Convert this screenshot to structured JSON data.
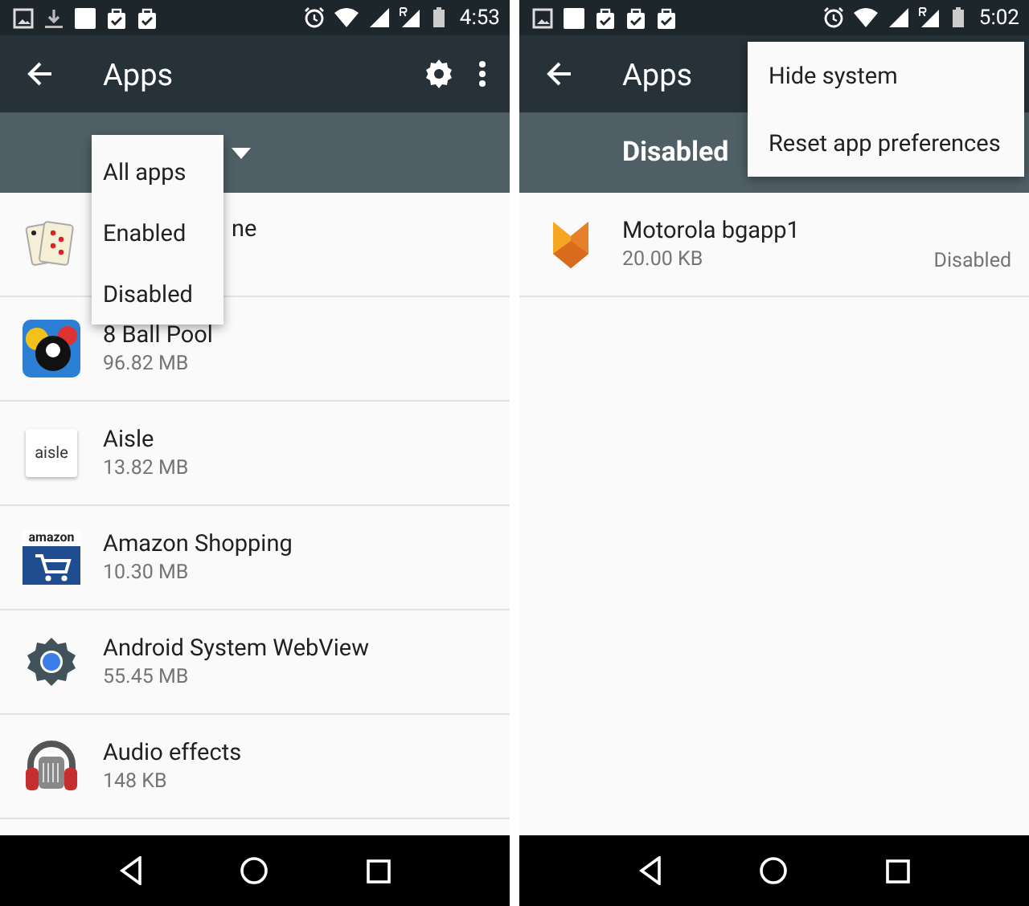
{
  "screens": [
    {
      "status_bar": {
        "notification_icons": [
          {
            "kind": "image"
          },
          {
            "kind": "download"
          },
          {
            "kind": "blank"
          },
          {
            "kind": "clipboard"
          },
          {
            "kind": "clipboard"
          }
        ],
        "system_icons": [
          {
            "kind": "alarm"
          },
          {
            "kind": "wifi"
          },
          {
            "kind": "signal"
          },
          {
            "kind": "roaming"
          },
          {
            "kind": "battery"
          }
        ],
        "time": "4:53"
      },
      "toolbar": {
        "title": "Apps",
        "actions": [
          {
            "kind": "settings"
          },
          {
            "kind": "more"
          }
        ]
      },
      "filter": {
        "expanded": true,
        "options": [
          {
            "label": "All apps"
          },
          {
            "label": "Enabled"
          },
          {
            "label": "Disabled"
          }
        ]
      },
      "apps": [
        {
          "kind": "cards",
          "name": "ne",
          "partial": true
        },
        {
          "kind": "pool",
          "name": "8 Ball Pool",
          "size": "96.82 MB"
        },
        {
          "kind": "wordmark",
          "icon_text": "aisle",
          "name": "Aisle",
          "size": "13.82 MB"
        },
        {
          "kind": "cart",
          "icon_text": "amazon",
          "name": "Amazon Shopping",
          "size": "10.30 MB"
        },
        {
          "kind": "gear",
          "name": "Android System WebView",
          "size": "55.45 MB"
        },
        {
          "kind": "headphones",
          "name": "Audio effects",
          "size": "148 KB"
        }
      ]
    },
    {
      "status_bar": {
        "notification_icons": [
          {
            "kind": "image"
          },
          {
            "kind": "blank"
          },
          {
            "kind": "clipboard"
          },
          {
            "kind": "clipboard"
          },
          {
            "kind": "clipboard"
          }
        ],
        "system_icons": [
          {
            "kind": "alarm"
          },
          {
            "kind": "wifi"
          },
          {
            "kind": "signal"
          },
          {
            "kind": "roaming"
          },
          {
            "kind": "battery"
          }
        ],
        "time": "5:02"
      },
      "toolbar": {
        "title": "Apps"
      },
      "filter": {
        "label": "Disabled",
        "expanded": false
      },
      "overflow_menu": {
        "items": [
          {
            "label": "Hide system"
          },
          {
            "label": "Reset app preferences"
          }
        ]
      },
      "apps": [
        {
          "kind": "shield",
          "name": "Motorola bgapp1",
          "size": "20.00 KB",
          "status": "Disabled"
        }
      ]
    }
  ]
}
